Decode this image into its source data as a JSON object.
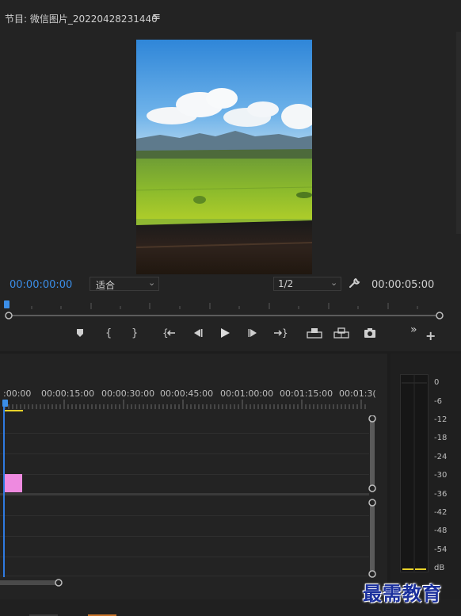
{
  "program_monitor": {
    "title": "节目: 微信图片_20220428231440",
    "menu_icon": "hamburger-menu-icon",
    "current_timecode": "00:00:00:00",
    "duration_timecode": "00:00:05:00",
    "zoom_select": "适合",
    "resolution_select": "1/2",
    "settings_icon": "wrench-icon",
    "playback_progress": 0.0,
    "transport_buttons": [
      {
        "name": "add-marker-button",
        "glyph": "▼",
        "icon": "marker-icon"
      },
      {
        "name": "mark-in-button",
        "glyph": "{",
        "icon": "mark-in-icon"
      },
      {
        "name": "mark-out-button",
        "glyph": "}",
        "icon": "mark-out-icon"
      },
      {
        "name": "go-to-in-button",
        "glyph": "{←",
        "icon": "go-to-in-icon"
      },
      {
        "name": "step-back-button",
        "glyph": "◀|",
        "icon": "step-back-icon"
      },
      {
        "name": "play-button",
        "glyph": "▶",
        "icon": "play-icon"
      },
      {
        "name": "step-forward-button",
        "glyph": "|▶",
        "icon": "step-forward-icon"
      },
      {
        "name": "go-to-out-button",
        "glyph": "→}",
        "icon": "go-to-out-icon"
      },
      {
        "name": "lift-button",
        "glyph": "⊓",
        "icon": "lift-icon"
      },
      {
        "name": "extract-button",
        "glyph": "⊔",
        "icon": "extract-icon"
      },
      {
        "name": "export-frame-button",
        "glyph": "◉",
        "icon": "camera-icon"
      }
    ],
    "overflow_glyph": "»",
    "add_glyph": "+"
  },
  "timeline": {
    "ruler_labels": [
      ":00:00",
      "00:00:15:00",
      "00:00:30:00",
      "00:00:45:00",
      "00:01:00:00",
      "00:01:15:00",
      "00:01:3("
    ],
    "clip_color": "#ee8ae0",
    "playhead_color": "#2f7ae0"
  },
  "audio_meter": {
    "scale": [
      "0",
      "-6",
      "-12",
      "-18",
      "-24",
      "-30",
      "-36",
      "-42",
      "-48",
      "-54",
      "dB"
    ]
  },
  "watermark": "最需教育"
}
